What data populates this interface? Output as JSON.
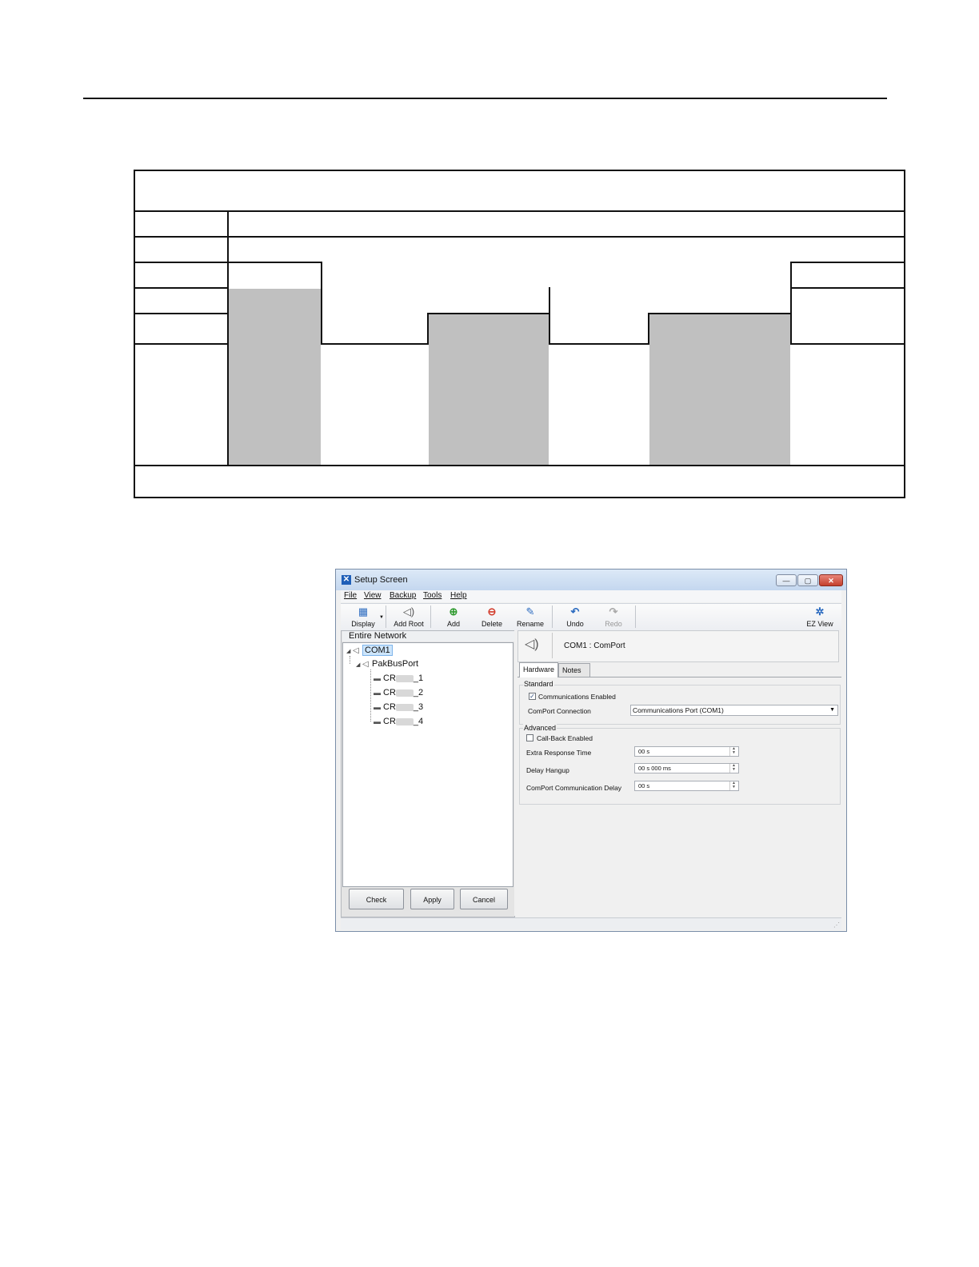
{
  "window": {
    "title": "Setup Screen",
    "controls": {
      "minimize": "—",
      "maximize": "▢",
      "close": "✕"
    }
  },
  "menu": [
    "File",
    "View",
    "Backup",
    "Tools",
    "Help"
  ],
  "toolbar": {
    "display": "Display",
    "add_root": "Add Root",
    "add": "Add",
    "delete": "Delete",
    "rename": "Rename",
    "undo": "Undo",
    "redo": "Redo",
    "ez_view": "EZ View"
  },
  "tree": {
    "header": "Entire Network",
    "root": "COM1",
    "port": "PakBusPort",
    "dataloggers": [
      {
        "prefix": "CR",
        "suffix": "_1"
      },
      {
        "prefix": "CR",
        "suffix": "_2"
      },
      {
        "prefix": "CR",
        "suffix": "_3"
      },
      {
        "prefix": "CR",
        "suffix": "_4"
      }
    ]
  },
  "buttons": {
    "check": "Check",
    "apply": "Apply",
    "cancel": "Cancel"
  },
  "detail": {
    "heading": "COM1 : ComPort",
    "tabs": [
      "Hardware",
      "Notes"
    ],
    "standard": {
      "title": "Standard",
      "communications_enabled_label": "Communications Enabled",
      "communications_enabled": true,
      "comport_connection_label": "ComPort Connection",
      "comport_connection_value": "Communications Port (COM1)"
    },
    "advanced": {
      "title": "Advanced",
      "callback_label": "Call-Back Enabled",
      "callback_enabled": false,
      "extra_response_label": "Extra Response Time",
      "extra_response_value": "00 s",
      "delay_hangup_label": "Delay Hangup",
      "delay_hangup_value": "00 s 000 ms",
      "comport_delay_label": "ComPort Communication Delay",
      "comport_delay_value": "00 s"
    }
  },
  "colors": {
    "shade": "#c0c0c0",
    "selection": "#cde5fb",
    "titlebar": "#c4d7ef"
  }
}
